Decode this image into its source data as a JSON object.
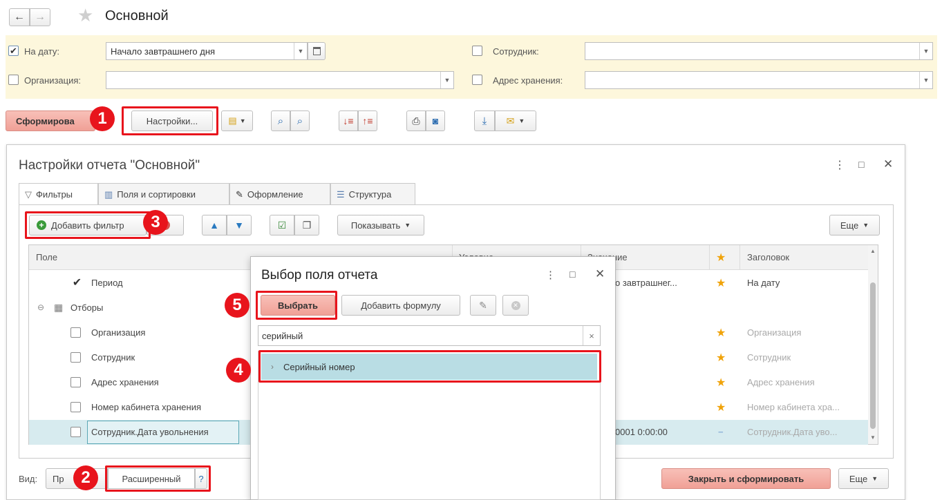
{
  "window": {
    "title": "Основной",
    "back_icon": "arrow-left-icon",
    "forward_icon": "arrow-right-icon",
    "favorite_icon": "star-icon"
  },
  "filters": {
    "date_label": "На дату:",
    "date_checked": true,
    "date_value": "Начало завтрашнего дня",
    "org_label": "Организация:",
    "org_value": "",
    "employee_label": "Сотрудник:",
    "employee_value": "",
    "storage_label": "Адрес хранения:",
    "storage_value": ""
  },
  "toolbar": {
    "generate_label": "Сформирова",
    "settings_label": "Настройки..."
  },
  "settings_dialog": {
    "title": "Настройки отчета \"Основной\"",
    "tabs": [
      {
        "label": "Фильтры",
        "icon": "filter-icon"
      },
      {
        "label": "Поля и сортировки",
        "icon": "columns-icon"
      },
      {
        "label": "Оформление",
        "icon": "brush-icon"
      },
      {
        "label": "Структура",
        "icon": "structure-icon"
      }
    ],
    "add_filter_label": "Добавить фильтр",
    "show_label": "Показывать",
    "more_label": "Еще",
    "columns": {
      "field": "Поле",
      "condition": "Условие",
      "value": "Значение",
      "title": "Заголовок"
    },
    "rows": [
      {
        "field": "Период",
        "checked": true,
        "value": "о завтрашнег...",
        "title": "На дату",
        "star": true
      },
      {
        "field": "Отборы",
        "group": true
      },
      {
        "field": "Организация",
        "checked": false,
        "title": "Организация",
        "star": true
      },
      {
        "field": "Сотрудник",
        "checked": false,
        "title": "Сотрудник",
        "star": true
      },
      {
        "field": "Адрес хранения",
        "checked": false,
        "title": "Адрес хранения",
        "star": true
      },
      {
        "field": "Номер кабинета хранения",
        "checked": false,
        "title": "Номер кабинета хра...",
        "star": true
      },
      {
        "field": "Сотрудник.Дата увольнения",
        "checked": false,
        "value": "0001 0:00:00",
        "title": "Сотрудник.Дата уво...",
        "star": false
      }
    ],
    "view_label": "Вид:",
    "view_simple": "Пр",
    "view_extended": "Расширенный",
    "help": "?",
    "close_generate_label": "Закрыть и сформировать",
    "more_bottom_label": "Еще"
  },
  "field_picker": {
    "title": "Выбор поля отчета",
    "select_label": "Выбрать",
    "add_formula_label": "Добавить формулу",
    "search_value": "серийный",
    "clear": "×",
    "items": [
      {
        "label": "Серийный номер"
      }
    ]
  },
  "badges": [
    "1",
    "2",
    "3",
    "4",
    "5"
  ],
  "colors": {
    "accent_red": "#e8141c",
    "highlight_row": "#b9dde4",
    "filter_bg": "#fdf7dc",
    "generate_btn": "#f3a8a0",
    "star": "#f0a30a"
  }
}
